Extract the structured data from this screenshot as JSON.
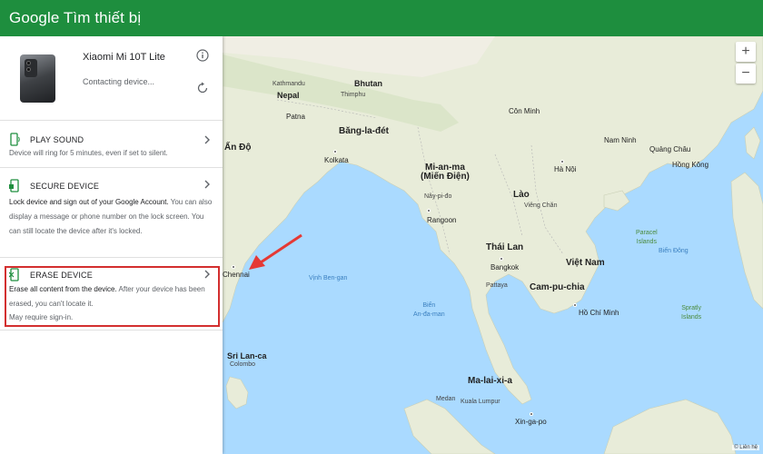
{
  "app": {
    "title": "Google Tìm thiết bị"
  },
  "device": {
    "name": "Xiaomi Mi 10T Lite",
    "status": "Contacting device...",
    "icons": {
      "info": "info-icon",
      "refresh": "refresh-icon"
    }
  },
  "actions": [
    {
      "label": "PLAY SOUND",
      "icon": "phone-ring-icon",
      "desc": "Device will ring for 5 minutes, even if set to silent."
    },
    {
      "label": "SECURE DEVICE",
      "icon": "phone-lock-icon",
      "desc_strong": "Lock device and sign out of your Google Account.",
      "desc_rest": " You can also display a message or phone number on the lock screen. You can still locate the device after it's locked."
    },
    {
      "label": "ERASE DEVICE",
      "icon": "phone-erase-icon",
      "desc_strong": "Erase all content from the device.",
      "desc_rest": " After your device has been erased, you can't locate it."
    }
  ],
  "footer_note": "May require sign-in.",
  "map": {
    "zoom_in": "+",
    "zoom_out": "−",
    "attribution": "© Liên hệ",
    "labels": {
      "india": "Ấn Độ",
      "nepal": "Nepal",
      "kathmandu": "Kathmandu",
      "bhutan": "Bhutan",
      "thimphu": "Thimphu",
      "patna": "Patna",
      "bangladesh": "Băng-la-đét",
      "kolkata": "Kolkata",
      "myanmar": "Mi-an-ma\n(Miến Điện)",
      "naypyidaw": "Nây-pi-đo",
      "yangon": "Rangoon",
      "thailand": "Thái Lan",
      "bangkok": "Bangkok",
      "laos": "Lào",
      "vientiane": "Viêng Chăn",
      "vietnam": "Việt Nam",
      "hanoi": "Hà Nội",
      "cambodia": "Cam-pu-chia",
      "hcmc": "Hồ Chí Minh",
      "kunming": "Côn Minh",
      "guangxi": "Nam Ninh",
      "guangzhou": "Quảng Châu",
      "hongkong": "Hồng Kông",
      "chennai": "Chennai",
      "srilanka": "Sri Lan-ca",
      "colombo": "Colombo",
      "bay_bengal": "Vịnh Ben-gan",
      "andaman": "Biển\nAn-đa-man",
      "malaysia": "Ma-lai-xi-a",
      "kualalumpur": "Kuala Lumpur",
      "singapore": "Xin-ga-po",
      "paracel": "Paracel\nIslands",
      "spratly": "Spratly\nIslands",
      "east_sea": "Biển Đông",
      "pattaya": "Pattaya",
      "medan": "Medan"
    }
  },
  "colors": {
    "topbar": "#1e8e3e",
    "highlight": "#d32f2f",
    "water": "#aadaff",
    "land": "#e8ecd9"
  }
}
